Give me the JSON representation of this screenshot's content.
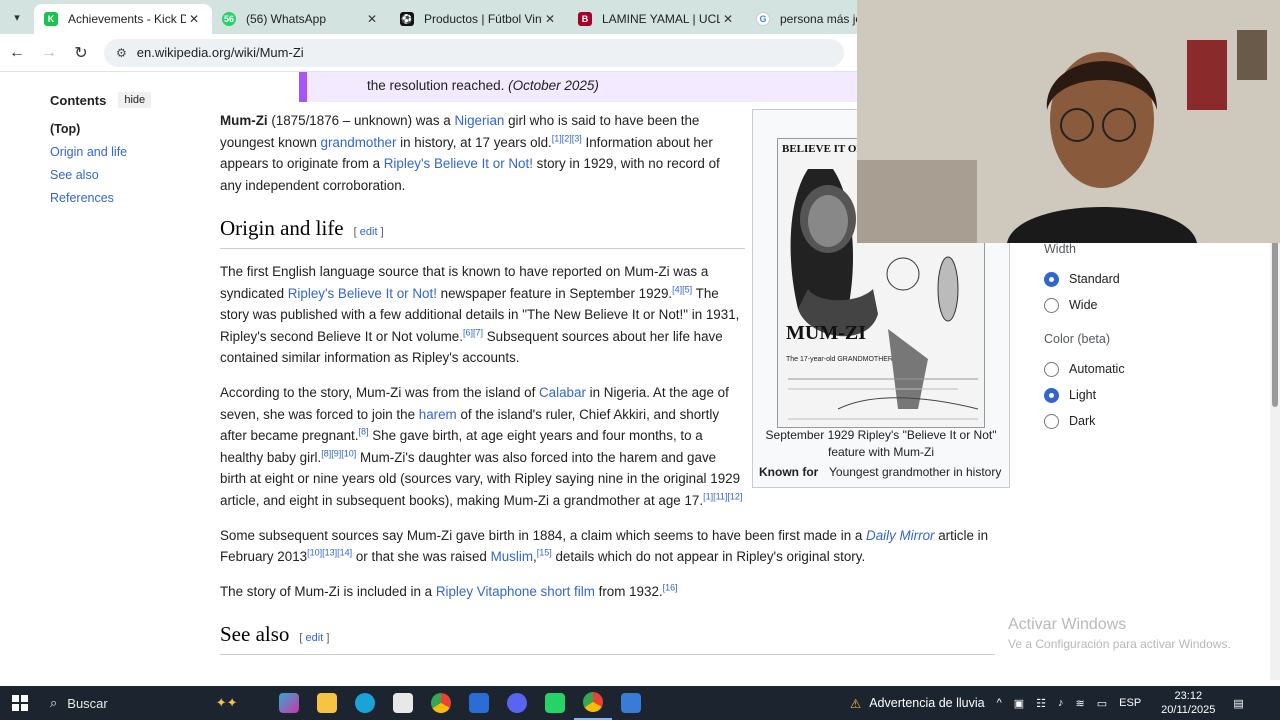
{
  "browser": {
    "tabs": [
      {
        "label": "Achievements - Kick Dashb",
        "icon_color": "#19c44c",
        "glyph": "K"
      },
      {
        "label": "(56) WhatsApp",
        "icon_color": "#25d366",
        "glyph": "56"
      },
      {
        "label": "Productos | Fútbol Vintage",
        "icon_color": "#111111",
        "glyph": "⚽"
      },
      {
        "label": "LAMINE YAMAL | UCL Cam",
        "icon_color": "#a3002e",
        "glyph": "B"
      },
      {
        "label": "persona más joven e",
        "icon_color": "#4285f4",
        "glyph": "G"
      }
    ],
    "url": "en.wikipedia.org/wiki/Mum-Zi"
  },
  "toc": {
    "title": "Contents",
    "hide_label": "hide",
    "items": [
      "(Top)",
      "Origin and life",
      "See also",
      "References"
    ]
  },
  "notice": {
    "text": "the resolution reached.",
    "date": "(October 2025)"
  },
  "article": {
    "intro": {
      "bold": "Mum-Zi",
      "t1": " (1875/1876 – unknown) was a ",
      "l1": "Nigerian",
      "t2": " girl who is said to have been the youngest known ",
      "l2": "grandmother",
      "t3": " in history, at 17 years old.",
      "s1": "[1][2][3]",
      "t4": " Information about her appears to originate from a ",
      "l3": "Ripley's Believe It or Not!",
      "t5": " story in 1929, with no record of any independent corroboration."
    },
    "section1": {
      "title": "Origin and life",
      "edit": "edit"
    },
    "p1": {
      "t1": "The first English language source that is known to have reported on Mum-Zi was a syndicated ",
      "l1": "Ripley's Believe It or Not!",
      "t2": " newspaper feature in September 1929.",
      "s1": "[4][5]",
      "t3": " The story was published with a few additional details in \"The New Believe It or Not!\" in 1931, Ripley's second Believe It or Not volume.",
      "s2": "[6][7]",
      "t4": " Subsequent sources about her life have contained similar information as Ripley's accounts."
    },
    "p2": {
      "t1": "According to the story, Mum-Zi was from the island of ",
      "l1": "Calabar",
      "t2": " in Nigeria. At the age of seven, she was forced to join the ",
      "l2": "harem",
      "t3": " of the island's ruler, Chief Akkiri, and shortly after became pregnant.",
      "s1": "[8]",
      "t4": " She gave birth, at age eight years and four months, to a healthy baby girl.",
      "s2": "[8][9][10]",
      "t5": " Mum-Zi's daughter was also forced into the harem and gave birth at eight or nine years old (sources vary, with Ripley saying nine in the original 1929 article, and eight in subsequent books), making Mum-Zi a grandmother at age 17.",
      "s3": "[1][11][12]"
    },
    "p3": {
      "t1": "Some subsequent sources say Mum-Zi gave birth in 1884, a claim which seems to have been first made in a ",
      "l1": "Daily Mirror",
      "t2": " article in February 2013",
      "s1": "[10][13][14]",
      "t3": " or that she was raised ",
      "l2": "Muslim",
      "t4": ",",
      "s2": "[15]",
      "t5": " details which do not appear in Ripley's original story."
    },
    "p4": {
      "t1": "The story of Mum-Zi is included in a ",
      "l1": "Ripley Vitaphone short film",
      "t2": " from 1932.",
      "s1": "[16]"
    },
    "section2": {
      "title": "See also",
      "edit": "edit"
    }
  },
  "infobox": {
    "clip_header": "BELIEVE IT OR NO",
    "clip_name": "MUM-ZI",
    "clip_sub": "The 17-year-old GRANDMOTHER",
    "caption": "September 1929 Ripley's \"Believe It or Not\" feature with Mum-Zi",
    "known_for_label": "Known for",
    "known_for_value": "Youngest grandmother in history"
  },
  "appearance": {
    "width_label": "Width",
    "width_options": [
      "Standard",
      "Wide"
    ],
    "width_selected": "Standard",
    "color_label": "Color (beta)",
    "color_options": [
      "Automatic",
      "Light",
      "Dark"
    ],
    "color_selected": "Light"
  },
  "watermark": {
    "line1": "Activar Windows",
    "line2": "Ve a Configuración para activar Windows."
  },
  "taskbar": {
    "search_placeholder": "Buscar",
    "weather": "Advertencia de lluvia",
    "lang": "ESP",
    "time": "23:12",
    "date": "20/11/2025"
  }
}
